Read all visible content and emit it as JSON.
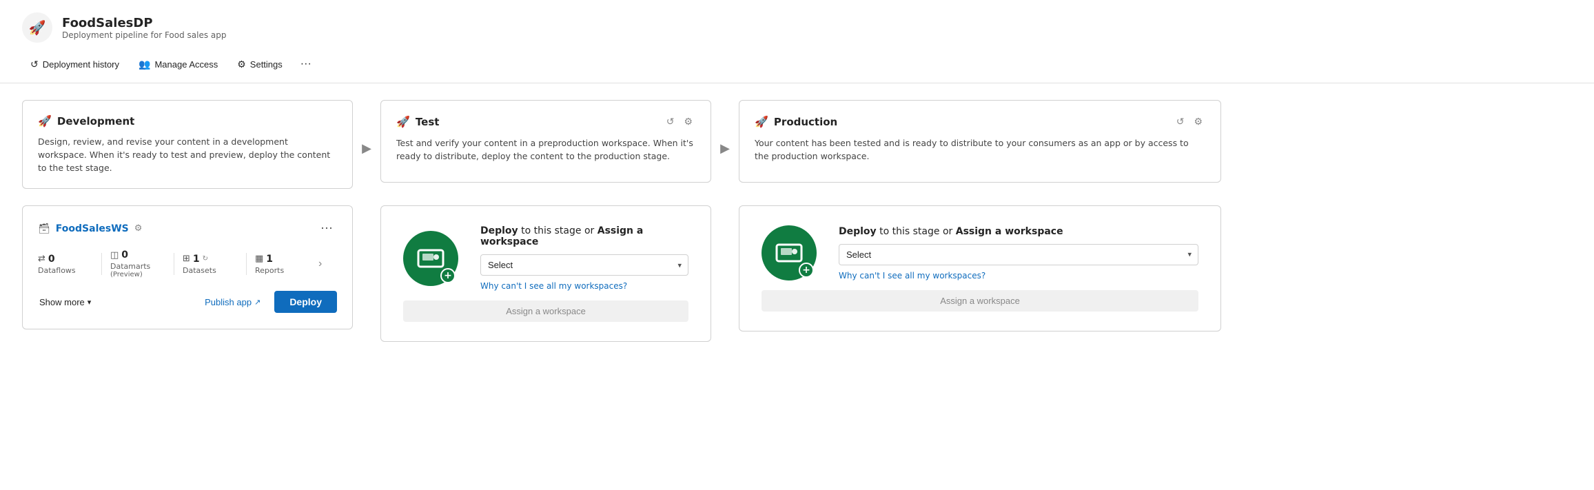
{
  "app": {
    "icon": "🚀",
    "title": "FoodSalesDP",
    "subtitle": "Deployment pipeline for Food sales app"
  },
  "toolbar": {
    "deployment_history_label": "Deployment history",
    "manage_access_label": "Manage Access",
    "settings_label": "Settings",
    "more_label": "···"
  },
  "stages": [
    {
      "id": "development",
      "icon": "🚀",
      "title": "Development",
      "description": "Design, review, and revise your content in a development workspace. When it's ready to test and preview, deploy the content to the test stage.",
      "has_history": false,
      "has_settings": false
    },
    {
      "id": "test",
      "icon": "🚀",
      "title": "Test",
      "description": "Test and verify your content in a preproduction workspace. When it's ready to distribute, deploy the content to the production stage.",
      "has_history": true,
      "has_settings": true
    },
    {
      "id": "production",
      "icon": "🚀",
      "title": "Production",
      "description": "Your content has been tested and is ready to distribute to your consumers as an app or by access to the production workspace.",
      "has_history": true,
      "has_settings": true
    }
  ],
  "workspace": {
    "name": "FoodSalesWS",
    "has_settings_icon": true,
    "stats": [
      {
        "icon": "⇄",
        "value": "0",
        "label": "Dataflows",
        "has_refresh": false
      },
      {
        "icon": "◫",
        "value": "0",
        "label": "Datamarts",
        "sublabel": "(Preview)",
        "has_refresh": false
      },
      {
        "icon": "⊞",
        "value": "1",
        "label": "Datasets",
        "has_refresh": true
      },
      {
        "icon": "▦",
        "value": "1",
        "label": "Reports",
        "has_refresh": false
      }
    ],
    "show_more_label": "Show more",
    "publish_app_label": "Publish app",
    "deploy_label": "Deploy"
  },
  "deploy_panels": [
    {
      "id": "test-deploy",
      "title_deploy": "Deploy",
      "title_or": "to this stage or",
      "title_assign": "Assign a workspace",
      "select_placeholder": "Select",
      "why_cant_label": "Why can't I see all my workspaces?",
      "assign_btn_label": "Assign a workspace"
    },
    {
      "id": "production-deploy",
      "title_deploy": "Deploy",
      "title_or": "to this stage or",
      "title_assign": "Assign a workspace",
      "select_placeholder": "Select",
      "why_cant_label": "Why can't I see all my workspaces?",
      "assign_btn_label": "Assign a workspace"
    }
  ]
}
